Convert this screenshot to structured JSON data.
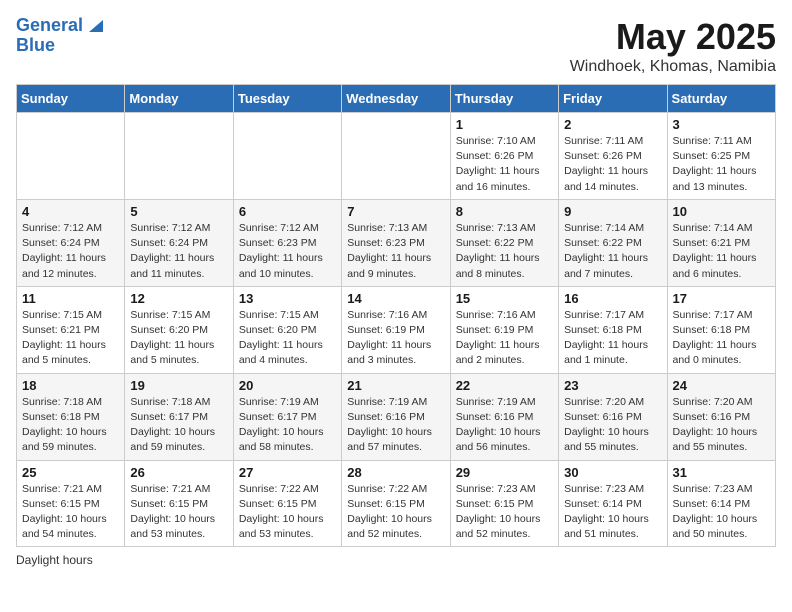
{
  "header": {
    "logo_line1": "General",
    "logo_line2": "Blue",
    "month_title": "May 2025",
    "location": "Windhoek, Khomas, Namibia"
  },
  "weekdays": [
    "Sunday",
    "Monday",
    "Tuesday",
    "Wednesday",
    "Thursday",
    "Friday",
    "Saturday"
  ],
  "weeks": [
    [
      {
        "day": "",
        "info": ""
      },
      {
        "day": "",
        "info": ""
      },
      {
        "day": "",
        "info": ""
      },
      {
        "day": "",
        "info": ""
      },
      {
        "day": "1",
        "info": "Sunrise: 7:10 AM\nSunset: 6:26 PM\nDaylight: 11 hours and 16 minutes."
      },
      {
        "day": "2",
        "info": "Sunrise: 7:11 AM\nSunset: 6:26 PM\nDaylight: 11 hours and 14 minutes."
      },
      {
        "day": "3",
        "info": "Sunrise: 7:11 AM\nSunset: 6:25 PM\nDaylight: 11 hours and 13 minutes."
      }
    ],
    [
      {
        "day": "4",
        "info": "Sunrise: 7:12 AM\nSunset: 6:24 PM\nDaylight: 11 hours and 12 minutes."
      },
      {
        "day": "5",
        "info": "Sunrise: 7:12 AM\nSunset: 6:24 PM\nDaylight: 11 hours and 11 minutes."
      },
      {
        "day": "6",
        "info": "Sunrise: 7:12 AM\nSunset: 6:23 PM\nDaylight: 11 hours and 10 minutes."
      },
      {
        "day": "7",
        "info": "Sunrise: 7:13 AM\nSunset: 6:23 PM\nDaylight: 11 hours and 9 minutes."
      },
      {
        "day": "8",
        "info": "Sunrise: 7:13 AM\nSunset: 6:22 PM\nDaylight: 11 hours and 8 minutes."
      },
      {
        "day": "9",
        "info": "Sunrise: 7:14 AM\nSunset: 6:22 PM\nDaylight: 11 hours and 7 minutes."
      },
      {
        "day": "10",
        "info": "Sunrise: 7:14 AM\nSunset: 6:21 PM\nDaylight: 11 hours and 6 minutes."
      }
    ],
    [
      {
        "day": "11",
        "info": "Sunrise: 7:15 AM\nSunset: 6:21 PM\nDaylight: 11 hours and 5 minutes."
      },
      {
        "day": "12",
        "info": "Sunrise: 7:15 AM\nSunset: 6:20 PM\nDaylight: 11 hours and 5 minutes."
      },
      {
        "day": "13",
        "info": "Sunrise: 7:15 AM\nSunset: 6:20 PM\nDaylight: 11 hours and 4 minutes."
      },
      {
        "day": "14",
        "info": "Sunrise: 7:16 AM\nSunset: 6:19 PM\nDaylight: 11 hours and 3 minutes."
      },
      {
        "day": "15",
        "info": "Sunrise: 7:16 AM\nSunset: 6:19 PM\nDaylight: 11 hours and 2 minutes."
      },
      {
        "day": "16",
        "info": "Sunrise: 7:17 AM\nSunset: 6:18 PM\nDaylight: 11 hours and 1 minute."
      },
      {
        "day": "17",
        "info": "Sunrise: 7:17 AM\nSunset: 6:18 PM\nDaylight: 11 hours and 0 minutes."
      }
    ],
    [
      {
        "day": "18",
        "info": "Sunrise: 7:18 AM\nSunset: 6:18 PM\nDaylight: 10 hours and 59 minutes."
      },
      {
        "day": "19",
        "info": "Sunrise: 7:18 AM\nSunset: 6:17 PM\nDaylight: 10 hours and 59 minutes."
      },
      {
        "day": "20",
        "info": "Sunrise: 7:19 AM\nSunset: 6:17 PM\nDaylight: 10 hours and 58 minutes."
      },
      {
        "day": "21",
        "info": "Sunrise: 7:19 AM\nSunset: 6:16 PM\nDaylight: 10 hours and 57 minutes."
      },
      {
        "day": "22",
        "info": "Sunrise: 7:19 AM\nSunset: 6:16 PM\nDaylight: 10 hours and 56 minutes."
      },
      {
        "day": "23",
        "info": "Sunrise: 7:20 AM\nSunset: 6:16 PM\nDaylight: 10 hours and 55 minutes."
      },
      {
        "day": "24",
        "info": "Sunrise: 7:20 AM\nSunset: 6:16 PM\nDaylight: 10 hours and 55 minutes."
      }
    ],
    [
      {
        "day": "25",
        "info": "Sunrise: 7:21 AM\nSunset: 6:15 PM\nDaylight: 10 hours and 54 minutes."
      },
      {
        "day": "26",
        "info": "Sunrise: 7:21 AM\nSunset: 6:15 PM\nDaylight: 10 hours and 53 minutes."
      },
      {
        "day": "27",
        "info": "Sunrise: 7:22 AM\nSunset: 6:15 PM\nDaylight: 10 hours and 53 minutes."
      },
      {
        "day": "28",
        "info": "Sunrise: 7:22 AM\nSunset: 6:15 PM\nDaylight: 10 hours and 52 minutes."
      },
      {
        "day": "29",
        "info": "Sunrise: 7:23 AM\nSunset: 6:15 PM\nDaylight: 10 hours and 52 minutes."
      },
      {
        "day": "30",
        "info": "Sunrise: 7:23 AM\nSunset: 6:14 PM\nDaylight: 10 hours and 51 minutes."
      },
      {
        "day": "31",
        "info": "Sunrise: 7:23 AM\nSunset: 6:14 PM\nDaylight: 10 hours and 50 minutes."
      }
    ]
  ],
  "footer": {
    "daylight_label": "Daylight hours"
  }
}
